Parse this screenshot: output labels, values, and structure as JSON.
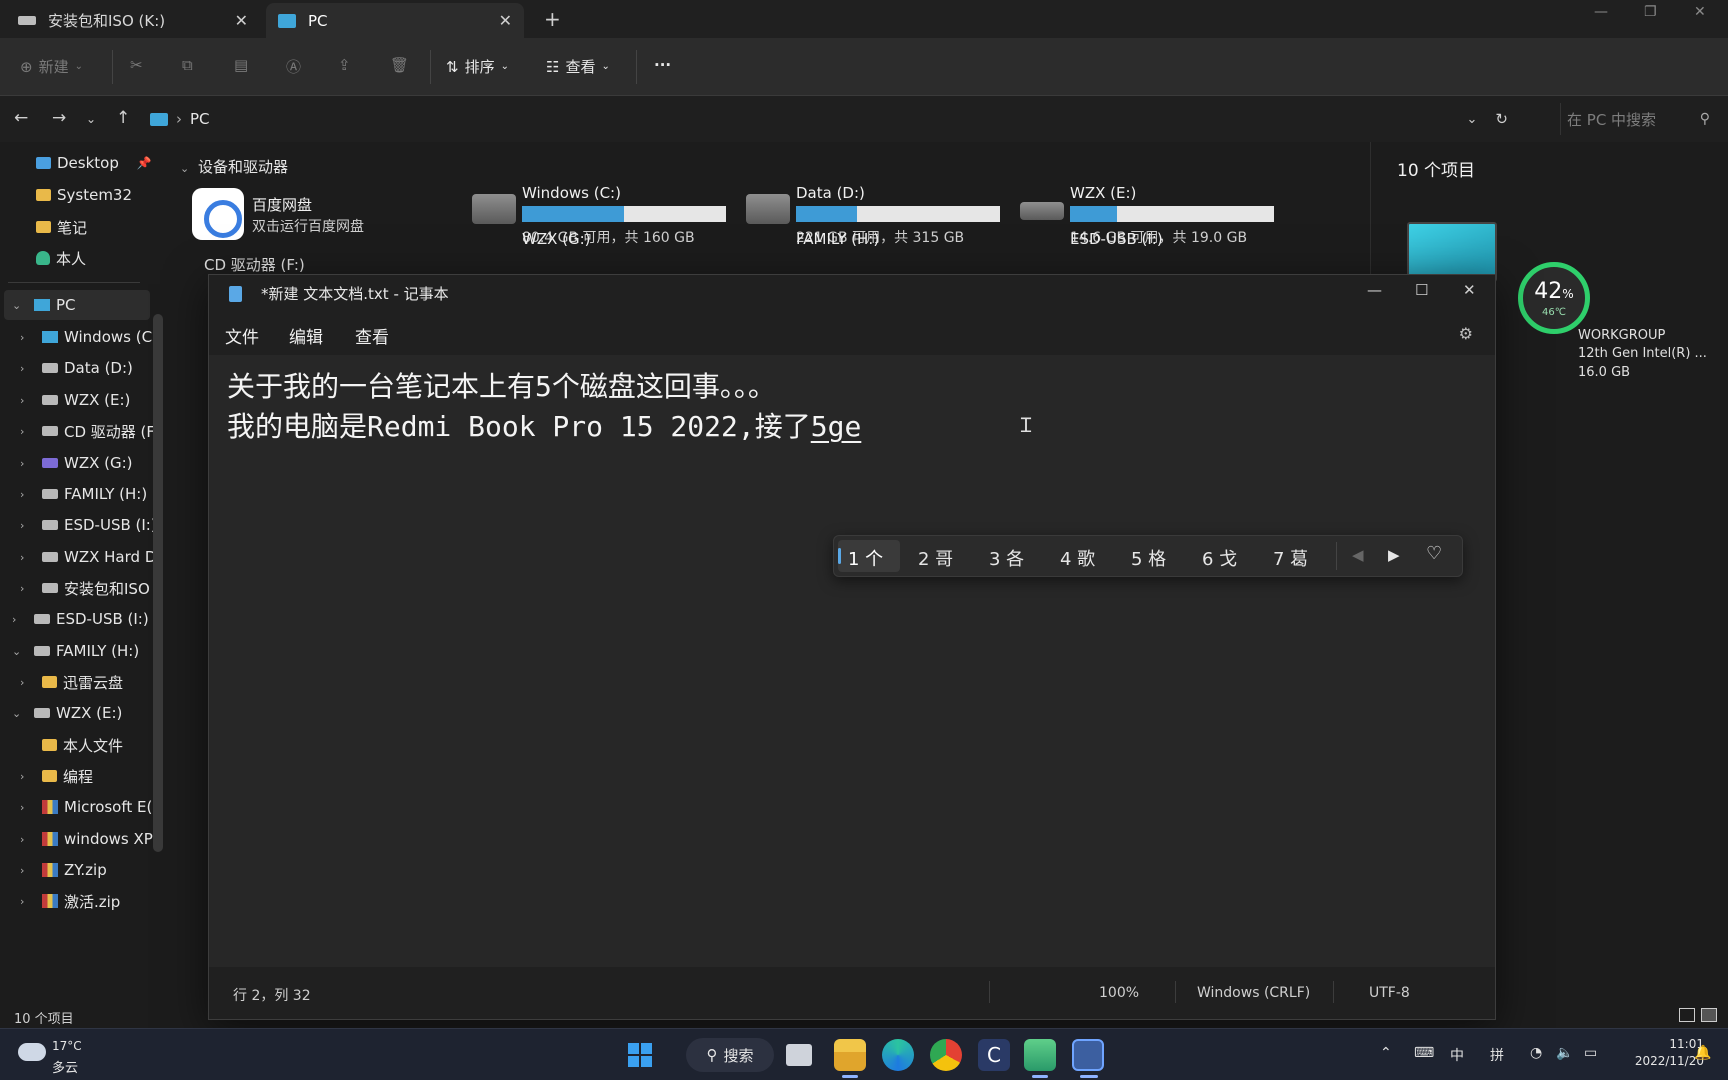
{
  "explorer": {
    "tabs": [
      {
        "label": "安装包和ISO (K:)",
        "close": "✕"
      },
      {
        "label": "PC",
        "close": "✕"
      }
    ],
    "new_tab": "+",
    "toolbar": {
      "new": "新建",
      "sort": "排序",
      "view": "查看",
      "more": "···"
    },
    "address": {
      "path": "PC",
      "search_placeholder": "在 PC 中搜索"
    },
    "sidebar": {
      "pinned": [
        "Desktop",
        "System32",
        "笔记",
        "本人"
      ],
      "tree": [
        {
          "label": "PC"
        },
        {
          "label": "Windows (C"
        },
        {
          "label": "Data (D:)"
        },
        {
          "label": "WZX (E:)"
        },
        {
          "label": "CD 驱动器 (F"
        },
        {
          "label": "WZX (G:)"
        },
        {
          "label": "FAMILY (H:)"
        },
        {
          "label": "ESD-USB (I:)"
        },
        {
          "label": "WZX Hard D"
        },
        {
          "label": "安装包和ISO"
        },
        {
          "label": "ESD-USB (I:)"
        },
        {
          "label": "FAMILY (H:)"
        },
        {
          "label": "迅雷云盘"
        },
        {
          "label": "WZX (E:)"
        },
        {
          "label": "本人文件"
        },
        {
          "label": "编程"
        },
        {
          "label": "Microsoft E("
        },
        {
          "label": "windows XP"
        },
        {
          "label": "ZY.zip"
        },
        {
          "label": "激活.zip"
        }
      ]
    },
    "content": {
      "group_title": "设备和驱动器",
      "baidu": {
        "name": "百度网盘",
        "sub": "双击运行百度网盘"
      },
      "drives": [
        {
          "name": "Windows (C:)",
          "free": "80.4 GB 可用，共 160 GB",
          "used_fraction": 0.5
        },
        {
          "name": "Data (D:)",
          "free": "221 GB 可用，共 315 GB",
          "used_fraction": 0.3
        },
        {
          "name": "WZX (E:)",
          "free": "14.6 GB 可用，共 19.0 GB",
          "used_fraction": 0.23
        }
      ],
      "drives_row2": [
        "WZX (G:)",
        "FAMILY (H:)",
        "ESD-USB (I:)"
      ],
      "cd_label": "CD 驱动器 (F:)"
    },
    "details": {
      "count": "10 个项目",
      "workgroup": "WORKGROUP",
      "cpu": "12th Gen Intel(R) ...",
      "ram": "16.0 GB"
    },
    "status_count": "10 个项目"
  },
  "gauge": {
    "percent": "42",
    "unit": "%",
    "temp": "46℃"
  },
  "notepad": {
    "title": "*新建 文本文档.txt - 记事本",
    "menu": [
      "文件",
      "编辑",
      "查看"
    ],
    "line1": "关于我的一台笔记本上有5个磁盘这回事。。。",
    "line2_committed": "我的电脑是Redmi Book Pro 15 2022,接了",
    "line2_composition": "5ge",
    "ime_candidates": [
      "1 个",
      "2 哥",
      "3 各",
      "4 歌",
      "5 格",
      "6 戈",
      "7 葛"
    ],
    "status": {
      "position": "行 2，列 32",
      "zoom": "100%",
      "line_ending": "Windows (CRLF)",
      "encoding": "UTF-8"
    }
  },
  "taskbar": {
    "weather_temp": "17°C",
    "weather_desc": "多云",
    "search": "搜索",
    "ime_lang": "中",
    "ime_mode": "拼",
    "time": "11:01",
    "date": "2022/11/20"
  },
  "colors": {
    "accent": "#3e9bd6",
    "gauge": "#2fcf6b",
    "folder": "#e9b949"
  }
}
